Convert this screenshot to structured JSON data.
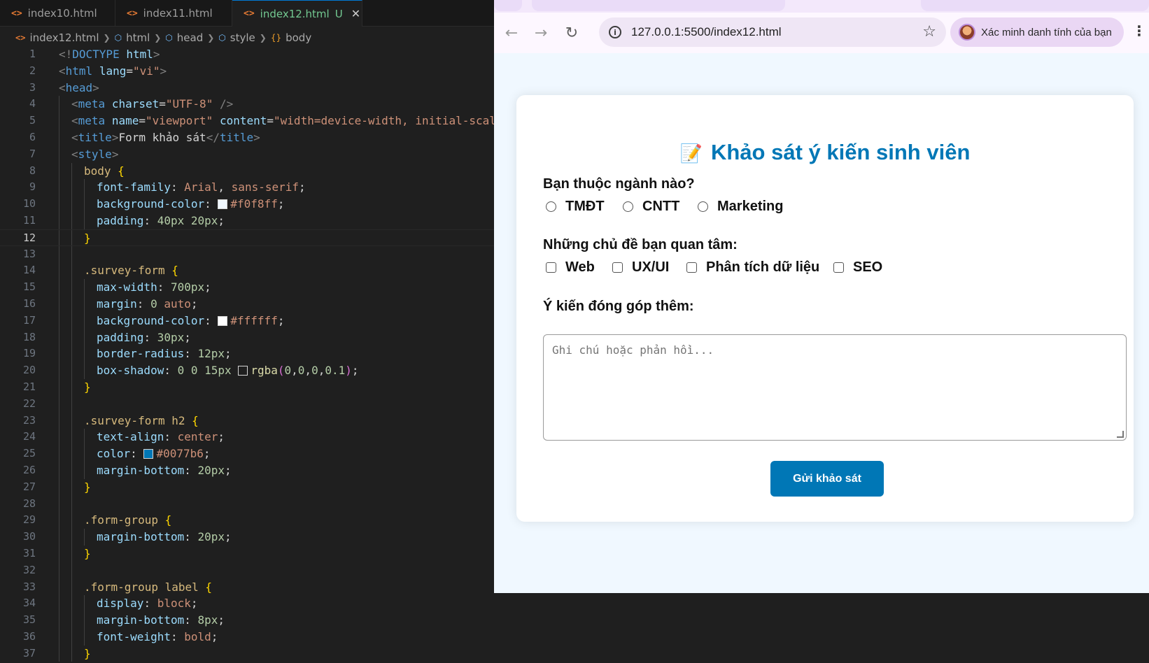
{
  "editor": {
    "tabs": [
      {
        "label": "index10.html",
        "active": false
      },
      {
        "label": "index11.html",
        "active": false
      },
      {
        "label": "index12.html",
        "active": true,
        "badge": "U"
      }
    ],
    "file_icon": "<>",
    "breadcrumb": [
      "index12.html",
      "html",
      "head",
      "style",
      "body"
    ],
    "current_line": "12",
    "lines": [
      {
        "n": "1",
        "indent": 0,
        "parts": [
          [
            "tag",
            "<!"
          ],
          [
            "name",
            "DOCTYPE"
          ],
          [
            "txt",
            " "
          ],
          [
            "attr",
            "html"
          ],
          [
            "tag",
            ">"
          ]
        ]
      },
      {
        "n": "2",
        "indent": 0,
        "parts": [
          [
            "tag",
            "<"
          ],
          [
            "name",
            "html"
          ],
          [
            "txt",
            " "
          ],
          [
            "attr",
            "lang"
          ],
          [
            "txt",
            "="
          ],
          [
            "str",
            "\"vi\""
          ],
          [
            "tag",
            ">"
          ]
        ]
      },
      {
        "n": "3",
        "indent": 0,
        "parts": [
          [
            "tag",
            "<"
          ],
          [
            "name",
            "head"
          ],
          [
            "tag",
            ">"
          ]
        ]
      },
      {
        "n": "4",
        "indent": 1,
        "parts": [
          [
            "tag",
            "<"
          ],
          [
            "name",
            "meta"
          ],
          [
            "txt",
            " "
          ],
          [
            "attr",
            "charset"
          ],
          [
            "txt",
            "="
          ],
          [
            "str",
            "\"UTF-8\""
          ],
          [
            "txt",
            " "
          ],
          [
            "tag",
            "/>"
          ]
        ]
      },
      {
        "n": "5",
        "indent": 1,
        "parts": [
          [
            "tag",
            "<"
          ],
          [
            "name",
            "meta"
          ],
          [
            "txt",
            " "
          ],
          [
            "attr",
            "name"
          ],
          [
            "txt",
            "="
          ],
          [
            "str",
            "\"viewport\""
          ],
          [
            "txt",
            " "
          ],
          [
            "attr",
            "content"
          ],
          [
            "txt",
            "="
          ],
          [
            "str",
            "\"width=device-width, initial-scal"
          ]
        ]
      },
      {
        "n": "6",
        "indent": 1,
        "parts": [
          [
            "tag",
            "<"
          ],
          [
            "name",
            "title"
          ],
          [
            "tag",
            ">"
          ],
          [
            "txt",
            "Form khảo sát"
          ],
          [
            "tag",
            "</"
          ],
          [
            "name",
            "title"
          ],
          [
            "tag",
            ">"
          ]
        ]
      },
      {
        "n": "7",
        "indent": 1,
        "parts": [
          [
            "tag",
            "<"
          ],
          [
            "name",
            "style"
          ],
          [
            "tag",
            ">"
          ]
        ]
      },
      {
        "n": "8",
        "indent": 2,
        "parts": [
          [
            "sel",
            "body"
          ],
          [
            "txt",
            " "
          ],
          [
            "br",
            "{"
          ]
        ]
      },
      {
        "n": "9",
        "indent": 3,
        "parts": [
          [
            "prop",
            "font-family"
          ],
          [
            "txt",
            ": "
          ],
          [
            "val",
            "Arial"
          ],
          [
            "txt",
            ", "
          ],
          [
            "val",
            "sans-serif"
          ],
          [
            "txt",
            ";"
          ]
        ]
      },
      {
        "n": "10",
        "indent": 3,
        "parts": [
          [
            "prop",
            "background-color"
          ],
          [
            "txt",
            ": "
          ],
          [
            "swatch",
            "#f0f8ff"
          ],
          [
            "val",
            "#f0f8ff"
          ],
          [
            "txt",
            ";"
          ]
        ]
      },
      {
        "n": "11",
        "indent": 3,
        "parts": [
          [
            "prop",
            "padding"
          ],
          [
            "txt",
            ": "
          ],
          [
            "num",
            "40px"
          ],
          [
            "txt",
            " "
          ],
          [
            "num",
            "20px"
          ],
          [
            "txt",
            ";"
          ]
        ]
      },
      {
        "n": "12",
        "indent": 2,
        "parts": [
          [
            "br",
            "}"
          ]
        ]
      },
      {
        "n": "13",
        "indent": 2,
        "parts": []
      },
      {
        "n": "14",
        "indent": 2,
        "parts": [
          [
            "sel",
            ".survey-form"
          ],
          [
            "txt",
            " "
          ],
          [
            "br",
            "{"
          ]
        ]
      },
      {
        "n": "15",
        "indent": 3,
        "parts": [
          [
            "prop",
            "max-width"
          ],
          [
            "txt",
            ": "
          ],
          [
            "num",
            "700px"
          ],
          [
            "txt",
            ";"
          ]
        ]
      },
      {
        "n": "16",
        "indent": 3,
        "parts": [
          [
            "prop",
            "margin"
          ],
          [
            "txt",
            ": "
          ],
          [
            "num",
            "0"
          ],
          [
            "txt",
            " "
          ],
          [
            "val",
            "auto"
          ],
          [
            "txt",
            ";"
          ]
        ]
      },
      {
        "n": "17",
        "indent": 3,
        "parts": [
          [
            "prop",
            "background-color"
          ],
          [
            "txt",
            ": "
          ],
          [
            "swatch",
            "#ffffff"
          ],
          [
            "val",
            "#ffffff"
          ],
          [
            "txt",
            ";"
          ]
        ]
      },
      {
        "n": "18",
        "indent": 3,
        "parts": [
          [
            "prop",
            "padding"
          ],
          [
            "txt",
            ": "
          ],
          [
            "num",
            "30px"
          ],
          [
            "txt",
            ";"
          ]
        ]
      },
      {
        "n": "19",
        "indent": 3,
        "parts": [
          [
            "prop",
            "border-radius"
          ],
          [
            "txt",
            ": "
          ],
          [
            "num",
            "12px"
          ],
          [
            "txt",
            ";"
          ]
        ]
      },
      {
        "n": "20",
        "indent": 3,
        "parts": [
          [
            "prop",
            "box-shadow"
          ],
          [
            "txt",
            ": "
          ],
          [
            "num",
            "0"
          ],
          [
            "txt",
            " "
          ],
          [
            "num",
            "0"
          ],
          [
            "txt",
            " "
          ],
          [
            "num",
            "15px"
          ],
          [
            "txt",
            " "
          ],
          [
            "swatch",
            "#1f1f1f"
          ],
          [
            "fn",
            "rgba"
          ],
          [
            "br2",
            "("
          ],
          [
            "num",
            "0"
          ],
          [
            "txt",
            ","
          ],
          [
            "num",
            "0"
          ],
          [
            "txt",
            ","
          ],
          [
            "num",
            "0"
          ],
          [
            "txt",
            ","
          ],
          [
            "num",
            "0.1"
          ],
          [
            "br2",
            ")"
          ],
          [
            "txt",
            ";"
          ]
        ]
      },
      {
        "n": "21",
        "indent": 2,
        "parts": [
          [
            "br",
            "}"
          ]
        ]
      },
      {
        "n": "22",
        "indent": 2,
        "parts": []
      },
      {
        "n": "23",
        "indent": 2,
        "parts": [
          [
            "sel",
            ".survey-form h2"
          ],
          [
            "txt",
            " "
          ],
          [
            "br",
            "{"
          ]
        ]
      },
      {
        "n": "24",
        "indent": 3,
        "parts": [
          [
            "prop",
            "text-align"
          ],
          [
            "txt",
            ": "
          ],
          [
            "val",
            "center"
          ],
          [
            "txt",
            ";"
          ]
        ]
      },
      {
        "n": "25",
        "indent": 3,
        "parts": [
          [
            "prop",
            "color"
          ],
          [
            "txt",
            ": "
          ],
          [
            "swatch",
            "#0077b6"
          ],
          [
            "val",
            "#0077b6"
          ],
          [
            "txt",
            ";"
          ]
        ]
      },
      {
        "n": "26",
        "indent": 3,
        "parts": [
          [
            "prop",
            "margin-bottom"
          ],
          [
            "txt",
            ": "
          ],
          [
            "num",
            "20px"
          ],
          [
            "txt",
            ";"
          ]
        ]
      },
      {
        "n": "27",
        "indent": 2,
        "parts": [
          [
            "br",
            "}"
          ]
        ]
      },
      {
        "n": "28",
        "indent": 2,
        "parts": []
      },
      {
        "n": "29",
        "indent": 2,
        "parts": [
          [
            "sel",
            ".form-group"
          ],
          [
            "txt",
            " "
          ],
          [
            "br",
            "{"
          ]
        ]
      },
      {
        "n": "30",
        "indent": 3,
        "parts": [
          [
            "prop",
            "margin-bottom"
          ],
          [
            "txt",
            ": "
          ],
          [
            "num",
            "20px"
          ],
          [
            "txt",
            ";"
          ]
        ]
      },
      {
        "n": "31",
        "indent": 2,
        "parts": [
          [
            "br",
            "}"
          ]
        ]
      },
      {
        "n": "32",
        "indent": 2,
        "parts": []
      },
      {
        "n": "33",
        "indent": 2,
        "parts": [
          [
            "sel",
            ".form-group label"
          ],
          [
            "txt",
            " "
          ],
          [
            "br",
            "{"
          ]
        ]
      },
      {
        "n": "34",
        "indent": 3,
        "parts": [
          [
            "prop",
            "display"
          ],
          [
            "txt",
            ": "
          ],
          [
            "val",
            "block"
          ],
          [
            "txt",
            ";"
          ]
        ]
      },
      {
        "n": "35",
        "indent": 3,
        "parts": [
          [
            "prop",
            "margin-bottom"
          ],
          [
            "txt",
            ": "
          ],
          [
            "num",
            "8px"
          ],
          [
            "txt",
            ";"
          ]
        ]
      },
      {
        "n": "36",
        "indent": 3,
        "parts": [
          [
            "prop",
            "font-weight"
          ],
          [
            "txt",
            ": "
          ],
          [
            "val",
            "bold"
          ],
          [
            "txt",
            ";"
          ]
        ]
      },
      {
        "n": "37",
        "indent": 2,
        "parts": [
          [
            "br",
            "}"
          ]
        ]
      }
    ]
  },
  "browser": {
    "url": "127.0.0.1:5500/index12.html",
    "profile_label": "Xác minh danh tính của bạn",
    "icons": {
      "back": "back-arrow-icon",
      "forward": "forward-arrow-icon",
      "reload": "reload-icon",
      "info": "site-info-icon",
      "star": "bookmark-star-icon",
      "menu": "kebab-menu-icon"
    }
  },
  "survey": {
    "emoji": "📝",
    "title": "Khảo sát ý kiến sinh viên",
    "major_question": "Bạn thuộc ngành nào?",
    "majors": [
      "TMĐT",
      "CNTT",
      "Marketing"
    ],
    "topics_question": "Những chủ đề bạn quan tâm:",
    "topics": [
      "Web",
      "UX/UI",
      "Phân tích dữ liệu",
      "SEO"
    ],
    "feedback_question": "Ý kiến đóng góp thêm:",
    "feedback_placeholder": "Ghi chú hoặc phản hồi...",
    "feedback_value": "",
    "submit_label": "Gửi khảo sát"
  },
  "colors": {
    "accent": "#0077b6",
    "page_bg": "#f0f8ff",
    "editor_bg": "#1f1f1f"
  }
}
